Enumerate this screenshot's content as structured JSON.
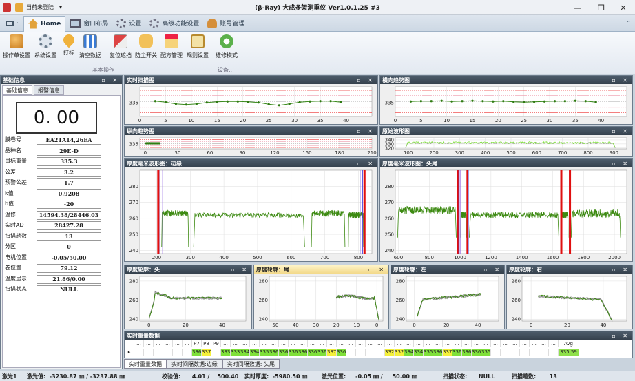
{
  "titlebar": {
    "quick": "当前未登陆",
    "title": "(β-Ray) 大成多架测重仪 Ver1.0.1.25 #3",
    "minimize": "—",
    "restore": "❐",
    "close": "✕"
  },
  "ribbon": {
    "tabs": [
      {
        "label": ""
      },
      {
        "label": "Home"
      },
      {
        "label": "窗口布局"
      },
      {
        "label": "设置"
      },
      {
        "label": "高级功能设置"
      },
      {
        "label": "账号管理"
      }
    ],
    "buttons": [
      "操作单设置",
      "系统设置",
      "打标",
      "清空数据",
      "复位遮挡",
      "防尘开关",
      "配方管理",
      "规则设置",
      "维修模式"
    ],
    "groups": [
      "基本操作",
      "设备..."
    ]
  },
  "left": {
    "title": "基础信息",
    "tabs": [
      "基础信息",
      "报警信息"
    ],
    "big_value": "0. 00",
    "fields": [
      {
        "k": "膜卷号",
        "v": "EA21A14,26EA"
      },
      {
        "k": "品种名",
        "v": "29E-D"
      },
      {
        "k": "目标重量",
        "v": "335.3"
      },
      {
        "k": "公差",
        "v": "3.2"
      },
      {
        "k": "预警公差",
        "v": "1.7"
      },
      {
        "k": "k值",
        "v": "0.9208"
      },
      {
        "k": "b值",
        "v": "-20"
      },
      {
        "k": "温修",
        "v": "14594.38/28446.03"
      },
      {
        "k": "实时AD",
        "v": "28427.28"
      },
      {
        "k": "扫描趟数",
        "v": "13"
      },
      {
        "k": "分区",
        "v": "0"
      },
      {
        "k": "电机位置",
        "v": "-0.05/50.00"
      },
      {
        "k": "卷位置",
        "v": "79.12"
      },
      {
        "k": "温度显示",
        "v": "21.86/0.00"
      },
      {
        "k": "扫描状态",
        "v": "NULL"
      }
    ]
  },
  "panels": {
    "p1": "实时扫描图",
    "p2": "横向趋势图",
    "p3": "纵向趋势图",
    "p4": "原始波形图",
    "p5": "厚度毫米波形图：边缘",
    "p6": "厚度毫米波形图：头尾",
    "p7": "厚度轮廓：头",
    "p8": "厚度轮廓：尾",
    "p9": "厚度轮廓：左",
    "p10": "厚度轮廓：右",
    "p11": "实时重量数据",
    "ctl": "▫ ✕"
  },
  "table": {
    "headers": [
      "...",
      "...",
      "...",
      "...",
      "...",
      "...",
      "P7",
      "P8",
      "P9",
      "...",
      "...",
      "...",
      "...",
      "...",
      "...",
      "...",
      "...",
      "...",
      "...",
      "...",
      "...",
      "...",
      "...",
      "...",
      "...",
      "...",
      "...",
      "...",
      "...",
      "...",
      "...",
      "...",
      "...",
      "...",
      "...",
      "...",
      "...",
      "...",
      "...",
      "...",
      "...",
      "...",
      "...",
      "...",
      "Avg"
    ],
    "values": [
      "",
      "",
      "",
      "",
      "",
      "",
      "336",
      "337",
      "",
      "333",
      "333",
      "334",
      "334",
      "335",
      "336",
      "336",
      "336",
      "336",
      "336",
      "336",
      "337",
      "336",
      "",
      "",
      "",
      "",
      "332",
      "332",
      "334",
      "334",
      "335",
      "336",
      "337",
      "336",
      "336",
      "336",
      "335",
      "",
      "",
      "",
      "",
      "",
      "",
      "",
      "335.59"
    ]
  },
  "bottom_tabs": [
    "实时重量数据",
    "实时间隔数据:边缘",
    "实时间隔数据: 头尾"
  ],
  "status": {
    "items": [
      "激光1",
      "激光值:  -3230.87 ㎜ / -3237.88 ㎜",
      "校验值:      4.01 /    500.40",
      "实时厚度:  -5980.50 ㎜",
      "激光位置:     -0.05 ㎜ /     50.00 ㎜",
      "扫描状态:      NULL",
      "扫描趟数:       13"
    ]
  },
  "chart_data": [
    {
      "type": "line",
      "name": "实时扫描图",
      "x": [
        3,
        5,
        7,
        9,
        11,
        13,
        15,
        17,
        19,
        21,
        23,
        25,
        27,
        29,
        31,
        33,
        35,
        37,
        39
      ],
      "y": [
        335.4,
        335.1,
        334.6,
        334.4,
        334.6,
        335.0,
        335.2,
        335.3,
        335.3,
        335.2,
        335.0,
        334.5,
        334.2,
        334.6,
        335.1,
        335.3,
        335.4,
        335.4,
        335.1
      ],
      "xlim": [
        0,
        45
      ],
      "xticks": [
        0,
        5,
        10,
        15,
        20,
        25,
        30,
        35,
        40
      ],
      "ytick": "335",
      "target": 335.3
    },
    {
      "type": "line",
      "name": "横向趋势图",
      "x": [
        3,
        5,
        7,
        9,
        11,
        13,
        15,
        17,
        19,
        21,
        23,
        25,
        27,
        29,
        31,
        33,
        35,
        37,
        39
      ],
      "y": [
        335.3,
        335.4,
        335.4,
        335.5,
        335.3,
        335.4,
        335.5,
        335.4,
        335.3,
        335.4,
        335.2,
        335.1,
        335.2,
        335.3,
        335.4,
        335.4,
        335.5,
        335.4,
        335.1
      ],
      "xlim": [
        0,
        45
      ],
      "xticks": [
        0,
        5,
        10,
        15,
        20,
        25,
        30,
        35,
        40
      ],
      "ytick": "335",
      "target": 335.3
    },
    {
      "type": "line",
      "name": "纵向趋势图",
      "x": [
        1,
        2,
        3,
        4,
        5,
        6,
        7,
        8,
        9,
        10,
        11,
        12,
        13
      ],
      "y": [
        335.5,
        335.6,
        335.5,
        335.6,
        335.5,
        335.6,
        335.5,
        335.6,
        335.5,
        335.6,
        335.5,
        335.6,
        335.5
      ],
      "xlim": [
        -5,
        210
      ],
      "xticks": [
        0,
        30,
        60,
        90,
        120,
        150,
        180,
        210
      ],
      "ytick": "335",
      "target": 335.3
    },
    {
      "type": "line",
      "name": "原始波形图",
      "xlim": [
        50,
        950
      ],
      "xticks": [
        100,
        200,
        300,
        400,
        500,
        600,
        700,
        800,
        900
      ],
      "ylim": [
        318,
        345
      ],
      "yticks": [
        320,
        330,
        340
      ]
    },
    {
      "type": "line",
      "name": "厚度毫米波形图：边缘",
      "xlim": [
        150,
        840
      ],
      "xticks": [
        200,
        300,
        400,
        500,
        600,
        700,
        800
      ],
      "ylim": [
        238,
        290
      ],
      "yticks": [
        240,
        250,
        260,
        270,
        280
      ]
    },
    {
      "type": "line",
      "name": "厚度毫米波形图：头尾",
      "xlim": [
        580,
        2080
      ],
      "xticks": [
        600,
        800,
        1000,
        1200,
        1400,
        1600,
        1800,
        2000
      ],
      "ylim": [
        238,
        290
      ],
      "yticks": [
        240,
        250,
        260,
        270,
        280
      ]
    },
    {
      "type": "line",
      "name": "厚度轮廓：头",
      "xlim": [
        -5,
        53
      ],
      "xticks": [
        0,
        20,
        40
      ],
      "ylim": [
        238,
        285
      ],
      "yticks": [
        240,
        260,
        280
      ]
    },
    {
      "type": "line",
      "name": "厚度轮廓：尾",
      "xlim": [
        53,
        -3
      ],
      "xticks": [
        50,
        40,
        30,
        20,
        10,
        0
      ],
      "ylim": [
        238,
        285
      ],
      "yticks": [
        240,
        260,
        280
      ]
    },
    {
      "type": "line",
      "name": "厚度轮廓：左",
      "xlim": [
        -5,
        53
      ],
      "xticks": [
        0,
        20,
        40
      ],
      "ylim": [
        238,
        285
      ],
      "yticks": [
        240,
        260,
        280
      ]
    },
    {
      "type": "line",
      "name": "厚度轮廓：右",
      "xlim": [
        -5,
        53
      ],
      "xticks": [
        0,
        20,
        40
      ],
      "ylim": [
        238,
        285
      ],
      "yticks": [
        240,
        260,
        280
      ]
    }
  ]
}
